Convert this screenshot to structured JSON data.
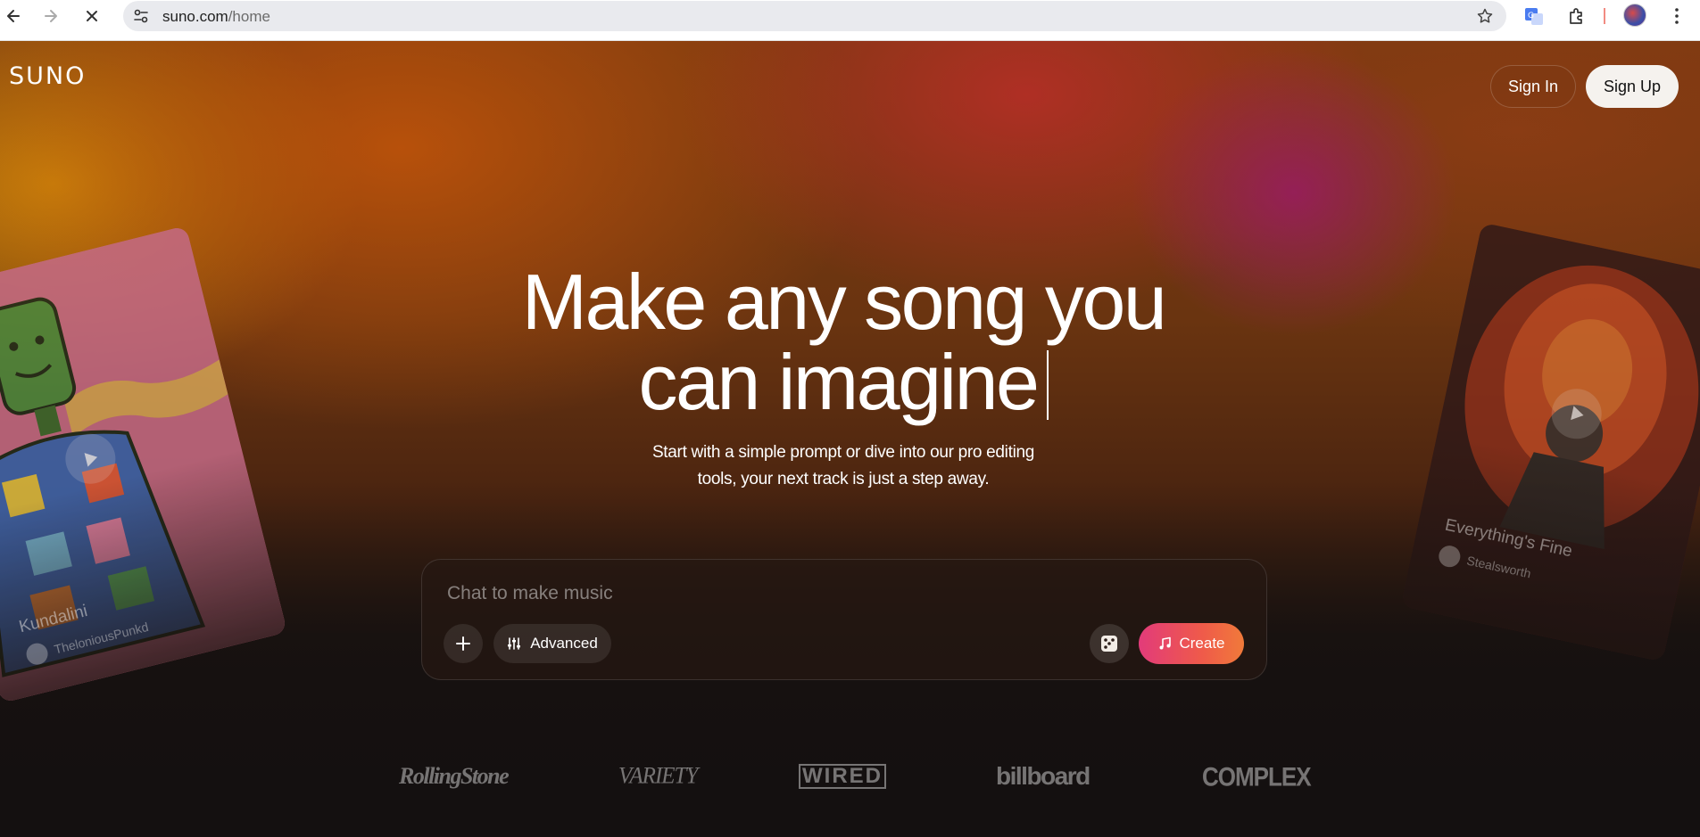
{
  "browser": {
    "url_host": "suno.com",
    "url_path": "/home"
  },
  "header": {
    "logo": "SUNO",
    "sign_in": "Sign In",
    "sign_up": "Sign Up"
  },
  "hero": {
    "headline_line1": "Make any song you",
    "headline_line2": "can imagine",
    "subtitle_line1": "Start with a simple prompt or dive into our pro editing",
    "subtitle_line2": "tools, your next track is just a step away."
  },
  "cards": {
    "left": {
      "title": "Kundalini",
      "artist": "TheloniousPunkd"
    },
    "right": {
      "title": "Everything's Fine",
      "artist": "Stealsworth"
    }
  },
  "composer": {
    "placeholder": "Chat to make music",
    "advanced_label": "Advanced",
    "create_label": "Create"
  },
  "press": [
    "RollingStone",
    "VARIETY",
    "WIRED",
    "billboard",
    "COMPLEX"
  ],
  "colors": {
    "create_gradient_start": "#e23b7a",
    "create_gradient_end": "#f07a3a",
    "signup_bg": "#f5f2ee"
  },
  "icons": {
    "back": "back-arrow-icon",
    "forward": "forward-arrow-icon",
    "stop": "close-icon",
    "site_info": "tune-icon",
    "bookmark": "star-icon",
    "translate": "translate-icon",
    "extensions": "puzzle-icon",
    "menu": "kebab-menu-icon"
  }
}
